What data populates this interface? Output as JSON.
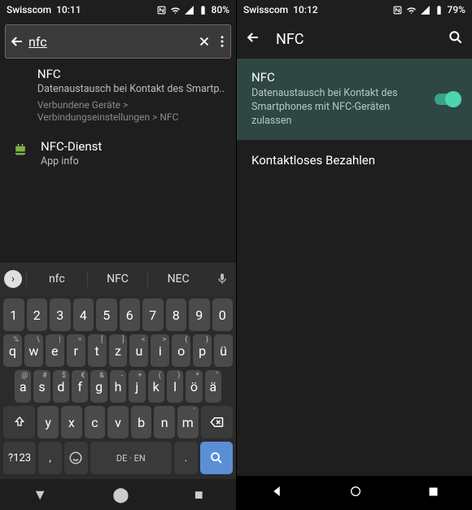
{
  "left": {
    "status": {
      "carrier": "Swisscom",
      "time": "10:11",
      "battery": "80%"
    },
    "search": {
      "value": "nfc"
    },
    "results": [
      {
        "title": "NFC",
        "subtitle": "Datenaustausch bei Kontakt des Smartp..",
        "path": "Verbundene Geräte > Verbindungseinstellungen > NFC"
      },
      {
        "title": "NFC-Dienst",
        "subtitle": "App info"
      }
    ],
    "suggestions": [
      "nfc",
      "NFC",
      "NEC"
    ],
    "keyboard": {
      "row1": [
        "1",
        "2",
        "3",
        "4",
        "5",
        "6",
        "7",
        "8",
        "9",
        "0"
      ],
      "row2": [
        "q",
        "w",
        "e",
        "r",
        "t",
        "z",
        "u",
        "i",
        "o",
        "p",
        "ü"
      ],
      "row2_sup": [
        "%",
        "\\",
        "|",
        "=",
        "[",
        "]",
        "<",
        ">",
        "{",
        "}",
        ""
      ],
      "row3": [
        "a",
        "s",
        "d",
        "f",
        "g",
        "h",
        "j",
        "k",
        "l",
        "ö",
        "ä"
      ],
      "row3_sup": [
        "@",
        "#",
        "$",
        "€",
        "&",
        "-",
        "+",
        "(",
        ")",
        "*",
        "\""
      ],
      "row4": [
        "y",
        "x",
        "c",
        "v",
        "b",
        "n",
        "m"
      ],
      "row4_sup": [
        "",
        "",
        "",
        "",
        "",
        "",
        "'"
      ],
      "sym": "?123",
      "space": "DE · EN"
    }
  },
  "right": {
    "status": {
      "carrier": "Swisscom",
      "time": "10:12",
      "battery": "79%"
    },
    "title": "NFC",
    "toggle": {
      "title": "NFC",
      "subtitle": "Datenaustausch bei Kontakt des Smartphones mit NFC-Geräten zulassen"
    },
    "item2": "Kontaktloses Bezahlen"
  }
}
